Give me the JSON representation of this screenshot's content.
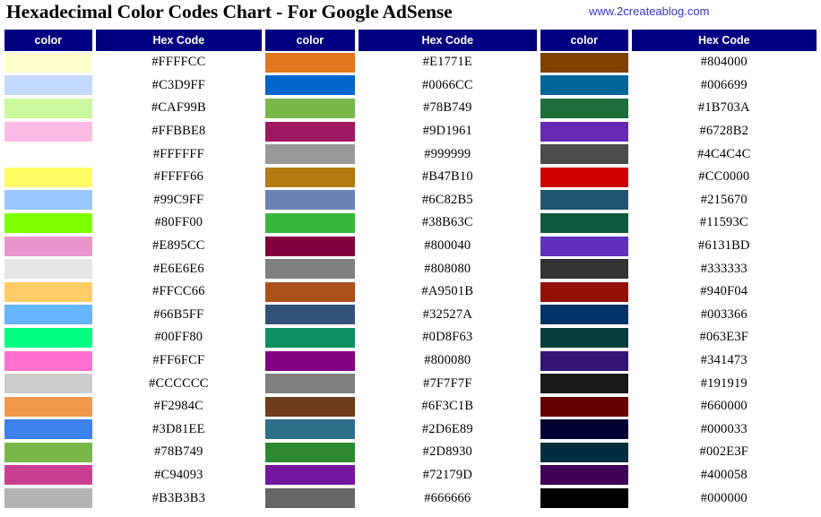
{
  "header": {
    "title": "Hexadecimal Color Codes Chart - For Google AdSense",
    "url": "www.2createablog.com"
  },
  "table": {
    "header_color_label": "color",
    "header_hex_label": "Hex Code",
    "header_bg": "#000080",
    "header_text_color": "#FFFFFF"
  },
  "chart_data": {
    "type": "table",
    "title": "Hexadecimal Color Codes Chart - For Google AdSense",
    "columns": [
      "color",
      "Hex Code",
      "color",
      "Hex Code",
      "color",
      "Hex Code"
    ],
    "column_groups": 3,
    "row_count": 20,
    "rows": [
      {
        "c1": "#FFFFCC",
        "c2": "#E1771E",
        "c3": "#804000"
      },
      {
        "c1": "#C3D9FF",
        "c2": "#0066CC",
        "c3": "#006699"
      },
      {
        "c1": "#CAF99B",
        "c2": "#78B749",
        "c3": "#1B703A"
      },
      {
        "c1": "#FFBBE8",
        "c2": "#9D1961",
        "c3": "#6728B2"
      },
      {
        "c1": "#FFFFFF",
        "c2": "#999999",
        "c3": "#4C4C4C"
      },
      {
        "c1": "#FFFF66",
        "c2": "#B47B10",
        "c3": "#CC0000"
      },
      {
        "c1": "#99C9FF",
        "c2": "#6C82B5",
        "c3": "#215670"
      },
      {
        "c1": "#80FF00",
        "c2": "#38B63C",
        "c3": "#11593C"
      },
      {
        "c1": "#E895CC",
        "c2": "#800040",
        "c3": "#6131BD"
      },
      {
        "c1": "#E6E6E6",
        "c2": "#808080",
        "c3": "#333333"
      },
      {
        "c1": "#FFCC66",
        "c2": "#A9501B",
        "c3": "#940F04"
      },
      {
        "c1": "#66B5FF",
        "c2": "#32527A",
        "c3": "#003366"
      },
      {
        "c1": "#00FF80",
        "c2": "#0D8F63",
        "c3": "#063E3F"
      },
      {
        "c1": "#FF6FCF",
        "c2": "#800080",
        "c3": "#341473"
      },
      {
        "c1": "#CCCCCC",
        "c2": "#7F7F7F",
        "c3": "#191919"
      },
      {
        "c1": "#F2984C",
        "c2": "#6F3C1B",
        "c3": "#660000"
      },
      {
        "c1": "#3D81EE",
        "c2": "#2D6E89",
        "c3": "#000033"
      },
      {
        "c1": "#78B749",
        "c2": "#2D8930",
        "c3": "#002E3F"
      },
      {
        "c1": "#C94093",
        "c2": "#72179D",
        "c3": "#400058"
      },
      {
        "c1": "#B3B3B3",
        "c2": "#666666",
        "c3": "#000000"
      }
    ]
  }
}
